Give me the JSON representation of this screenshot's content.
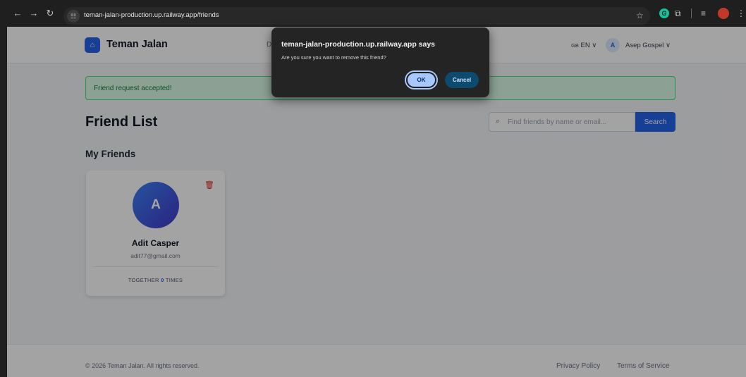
{
  "browser": {
    "url": "teman-jalan-production.up.railway.app/friends"
  },
  "app": {
    "brand": "Teman Jalan",
    "nav_peek": "D",
    "language_flag": "GB",
    "language": "EN",
    "user_initial": "A",
    "user_name": "Asep Gospel"
  },
  "alert": {
    "text": "Friend request accepted!"
  },
  "main": {
    "title": "Friend List",
    "search_placeholder": "Find friends by name or email...",
    "search_button": "Search",
    "section_title": "My Friends"
  },
  "friends": [
    {
      "initial": "A",
      "name": "Adit Casper",
      "email": "adit77@gmail.com",
      "together_prefix": "TOGETHER",
      "together_count": "0",
      "together_suffix": "TIMES"
    }
  ],
  "footer": {
    "copyright": "© 2026 Teman Jalan. All rights reserved.",
    "privacy": "Privacy Policy",
    "terms": "Terms of Service"
  },
  "dialog": {
    "title": "teman-jalan-production.up.railway.app says",
    "message": "Are you sure you want to remove this friend?",
    "ok": "OK",
    "cancel": "Cancel"
  },
  "colors": {
    "accent": "#2563eb",
    "success_bg": "#dcfce7",
    "success_text": "#15803d",
    "danger": "#dc2626"
  }
}
